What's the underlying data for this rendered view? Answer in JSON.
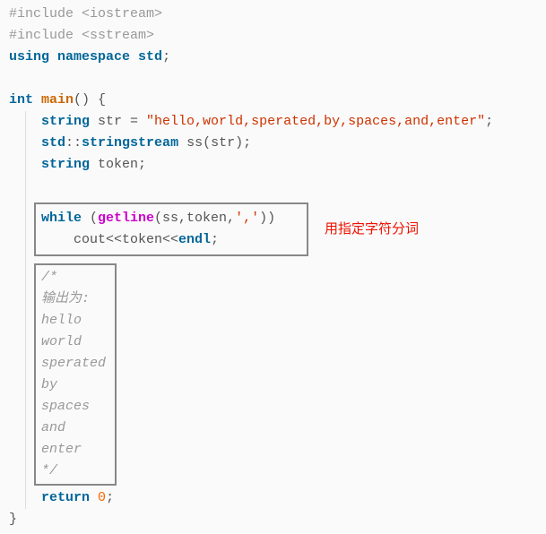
{
  "line1_pre": "#include ",
  "line1_hdr": "<iostream>",
  "line2_pre": "#include ",
  "line2_hdr": "<sstream>",
  "line3_using": "using",
  "line3_ns": " namespace ",
  "line3_std": "std",
  "line3_semi": ";",
  "line5_int": "int",
  "line5_sp1": " ",
  "line5_main": "main",
  "line5_paren": "() {",
  "line6_indent": "    ",
  "line6_string": "string",
  "line6_sp": " str = ",
  "line6_lit": "\"hello,world,sperated,by,spaces,and,enter\"",
  "line6_semi": ";",
  "line7_indent": "    ",
  "line7_std": "std",
  "line7_cc": "::",
  "line7_ss": "stringstream",
  "line7_rest": " ss(str);",
  "line8_indent": "    ",
  "line8_string": "string",
  "line8_rest": " token;",
  "while_kw": "while",
  "while_sp": " (",
  "while_getline": "getline",
  "while_args": "(ss,token,",
  "while_char": "','",
  "while_close": "))",
  "cout_indent": "    cout<<token<<",
  "cout_endl": "endl",
  "cout_semi": ";",
  "annotation": "用指定字符分词",
  "c1": "/*",
  "c2": "输出为:",
  "c3": "hello",
  "c4": "world",
  "c5": "sperated",
  "c6": "by",
  "c7": "spaces",
  "c8": "and",
  "c9": "enter",
  "c10": "*/",
  "ret_indent": "    ",
  "ret_kw": "return",
  "ret_sp": " ",
  "ret_num": "0",
  "ret_semi": ";",
  "close_brace": "}"
}
